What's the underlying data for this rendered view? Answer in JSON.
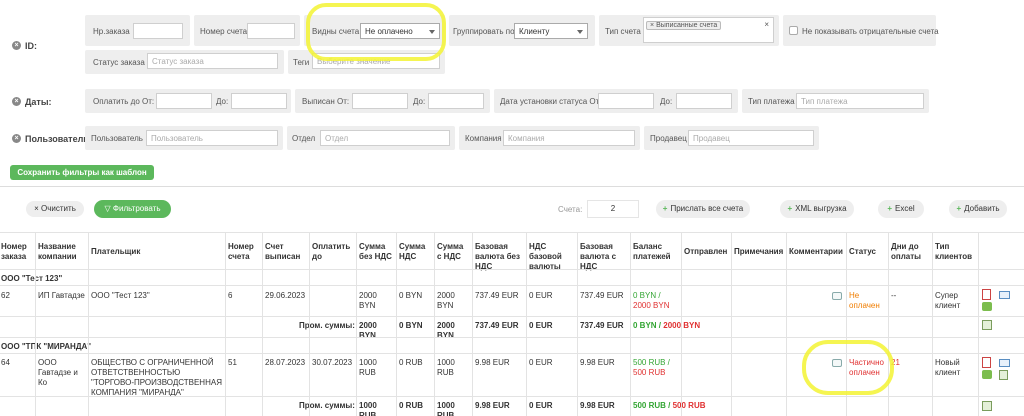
{
  "filters": {
    "id_row": {
      "label": "ID:",
      "order_no_label": "Нр.заказа",
      "invoice_no_label": "Номер счета",
      "invoice_view_label": "Видны счета",
      "invoice_view_value": "Не оплачено",
      "group_by_label": "Группировать по",
      "group_by_value": "Клиенту",
      "invoice_type_label": "Тип счета",
      "invoice_type_tag": "Выписанные счета",
      "hide_negative_label": "Не показывать отрицательные счета",
      "order_status_label": "Статус заказа",
      "order_status_placeholder": "Статус заказа",
      "tags_label": "Теги",
      "tags_placeholder": "Выберите значение"
    },
    "dates_row": {
      "label": "Даты:",
      "pay_until_from_label": "Оплатить до От:",
      "to_label_1": "До:",
      "issued_from_label": "Выписан От:",
      "to_label_2": "До:",
      "status_date_from_label": "Дата установки статуса От:",
      "to_label_3": "До:",
      "payment_type_label": "Тип платежа",
      "payment_type_placeholder": "Тип платежа"
    },
    "users_row": {
      "label": "Пользователи:",
      "user_label": "Пользователь",
      "user_placeholder": "Пользователь",
      "department_label": "Отдел",
      "department_placeholder": "Отдел",
      "company_label": "Компания",
      "company_placeholder": "Компания",
      "seller_label": "Продавец",
      "seller_placeholder": "Продавец"
    },
    "save_template_label": "Сохранить фильтры как шаблон"
  },
  "toolbar": {
    "clear_label": "Очистить",
    "filter_label": "Фильтровать",
    "count_label": "Счета:",
    "count_value": "2",
    "send_all_label": "Прислать все счета",
    "xml_label": "XML выгрузка",
    "excel_label": "Excel",
    "add_label": "Добавить"
  },
  "table": {
    "headers": {
      "order_no": "Номер заказа",
      "company": "Название компании",
      "payer": "Плательщик",
      "invoice_no": "Номер счета",
      "issued": "Счет выписан",
      "pay_until": "Оплатить до",
      "sum_no_vat": "Сумма без НДС",
      "vat": "Сумма НДС",
      "sum_vat": "Сумма с НДС",
      "base_no_vat": "Базовая валюта без НДС",
      "vat_base": "НДС базовой валюты",
      "base_vat": "Базовая валюта с НДС",
      "balance": "Баланс платежей",
      "sent": "Отправлен",
      "notes": "Примечания",
      "comments": "Комментарии",
      "status": "Статус",
      "days": "Дни до оплаты",
      "client_type": "Тип клиентов"
    },
    "groups": [
      {
        "name": "ООО \"Тест 123\"",
        "row": {
          "order_no": "62",
          "company": "ИП Гавтадзе",
          "payer": "ООО \"Тест 123\"",
          "invoice_no": "6",
          "issued": "29.06.2023",
          "pay_until": "",
          "sum_no_vat": "2000 BYN",
          "vat": "0 BYN",
          "sum_vat": "2000 BYN",
          "base_no_vat": "737.49 EUR",
          "vat_base": "0 EUR",
          "base_vat": "737.49 EUR",
          "balance_paid": "0 BYN /",
          "balance_total": "2000 BYN",
          "status": "Не оплачен",
          "days": "--",
          "client_type": "Супер клиент"
        },
        "totals": {
          "label": "Пром. суммы:",
          "sum_no_vat": "2000 BYN",
          "vat": "0 BYN",
          "sum_vat": "2000 BYN",
          "base_no_vat": "737.49 EUR",
          "vat_base": "0 EUR",
          "base_vat": "737.49 EUR",
          "balance_paid": "0 BYN /",
          "balance_total": "2000 BYN"
        }
      },
      {
        "name": "ООО \"ТПК \"МИРАНДА\"",
        "row": {
          "order_no": "64",
          "company": "ООО Гавтадзе и Ко",
          "payer": "ОБЩЕСТВО С ОГРАНИЧЕННОЙ ОТВЕТСТВЕННОСТЬЮ \"ТОРГОВО-ПРОИЗВОДСТВЕННАЯ КОМПАНИЯ \"МИРАНДА\"",
          "invoice_no": "51",
          "issued": "28.07.2023",
          "pay_until": "30.07.2023",
          "sum_no_vat": "1000 RUB",
          "vat": "0 RUB",
          "sum_vat": "1000 RUB",
          "base_no_vat": "9.98 EUR",
          "vat_base": "0 EUR",
          "base_vat": "9.98 EUR",
          "balance_paid": "500 RUB /",
          "balance_total": "500 RUB",
          "status": "Частично оплачен",
          "days": "21",
          "client_type": "Новый клиент"
        },
        "totals": {
          "label": "Пром. суммы:",
          "sum_no_vat": "1000 RUB",
          "vat": "0 RUB",
          "sum_vat": "1000 RUB",
          "base_no_vat": "9.98 EUR",
          "vat_base": "0 EUR",
          "base_vat": "9.98 EUR",
          "balance_paid": "500 RUB /",
          "balance_total": "500 RUB"
        }
      }
    ]
  },
  "colors": {
    "green_button": "#5cb85c",
    "highlight": "#f3f333",
    "status_unpaid": "#f07d00",
    "status_partial": "#e03030",
    "paid_green": "#33a533"
  }
}
